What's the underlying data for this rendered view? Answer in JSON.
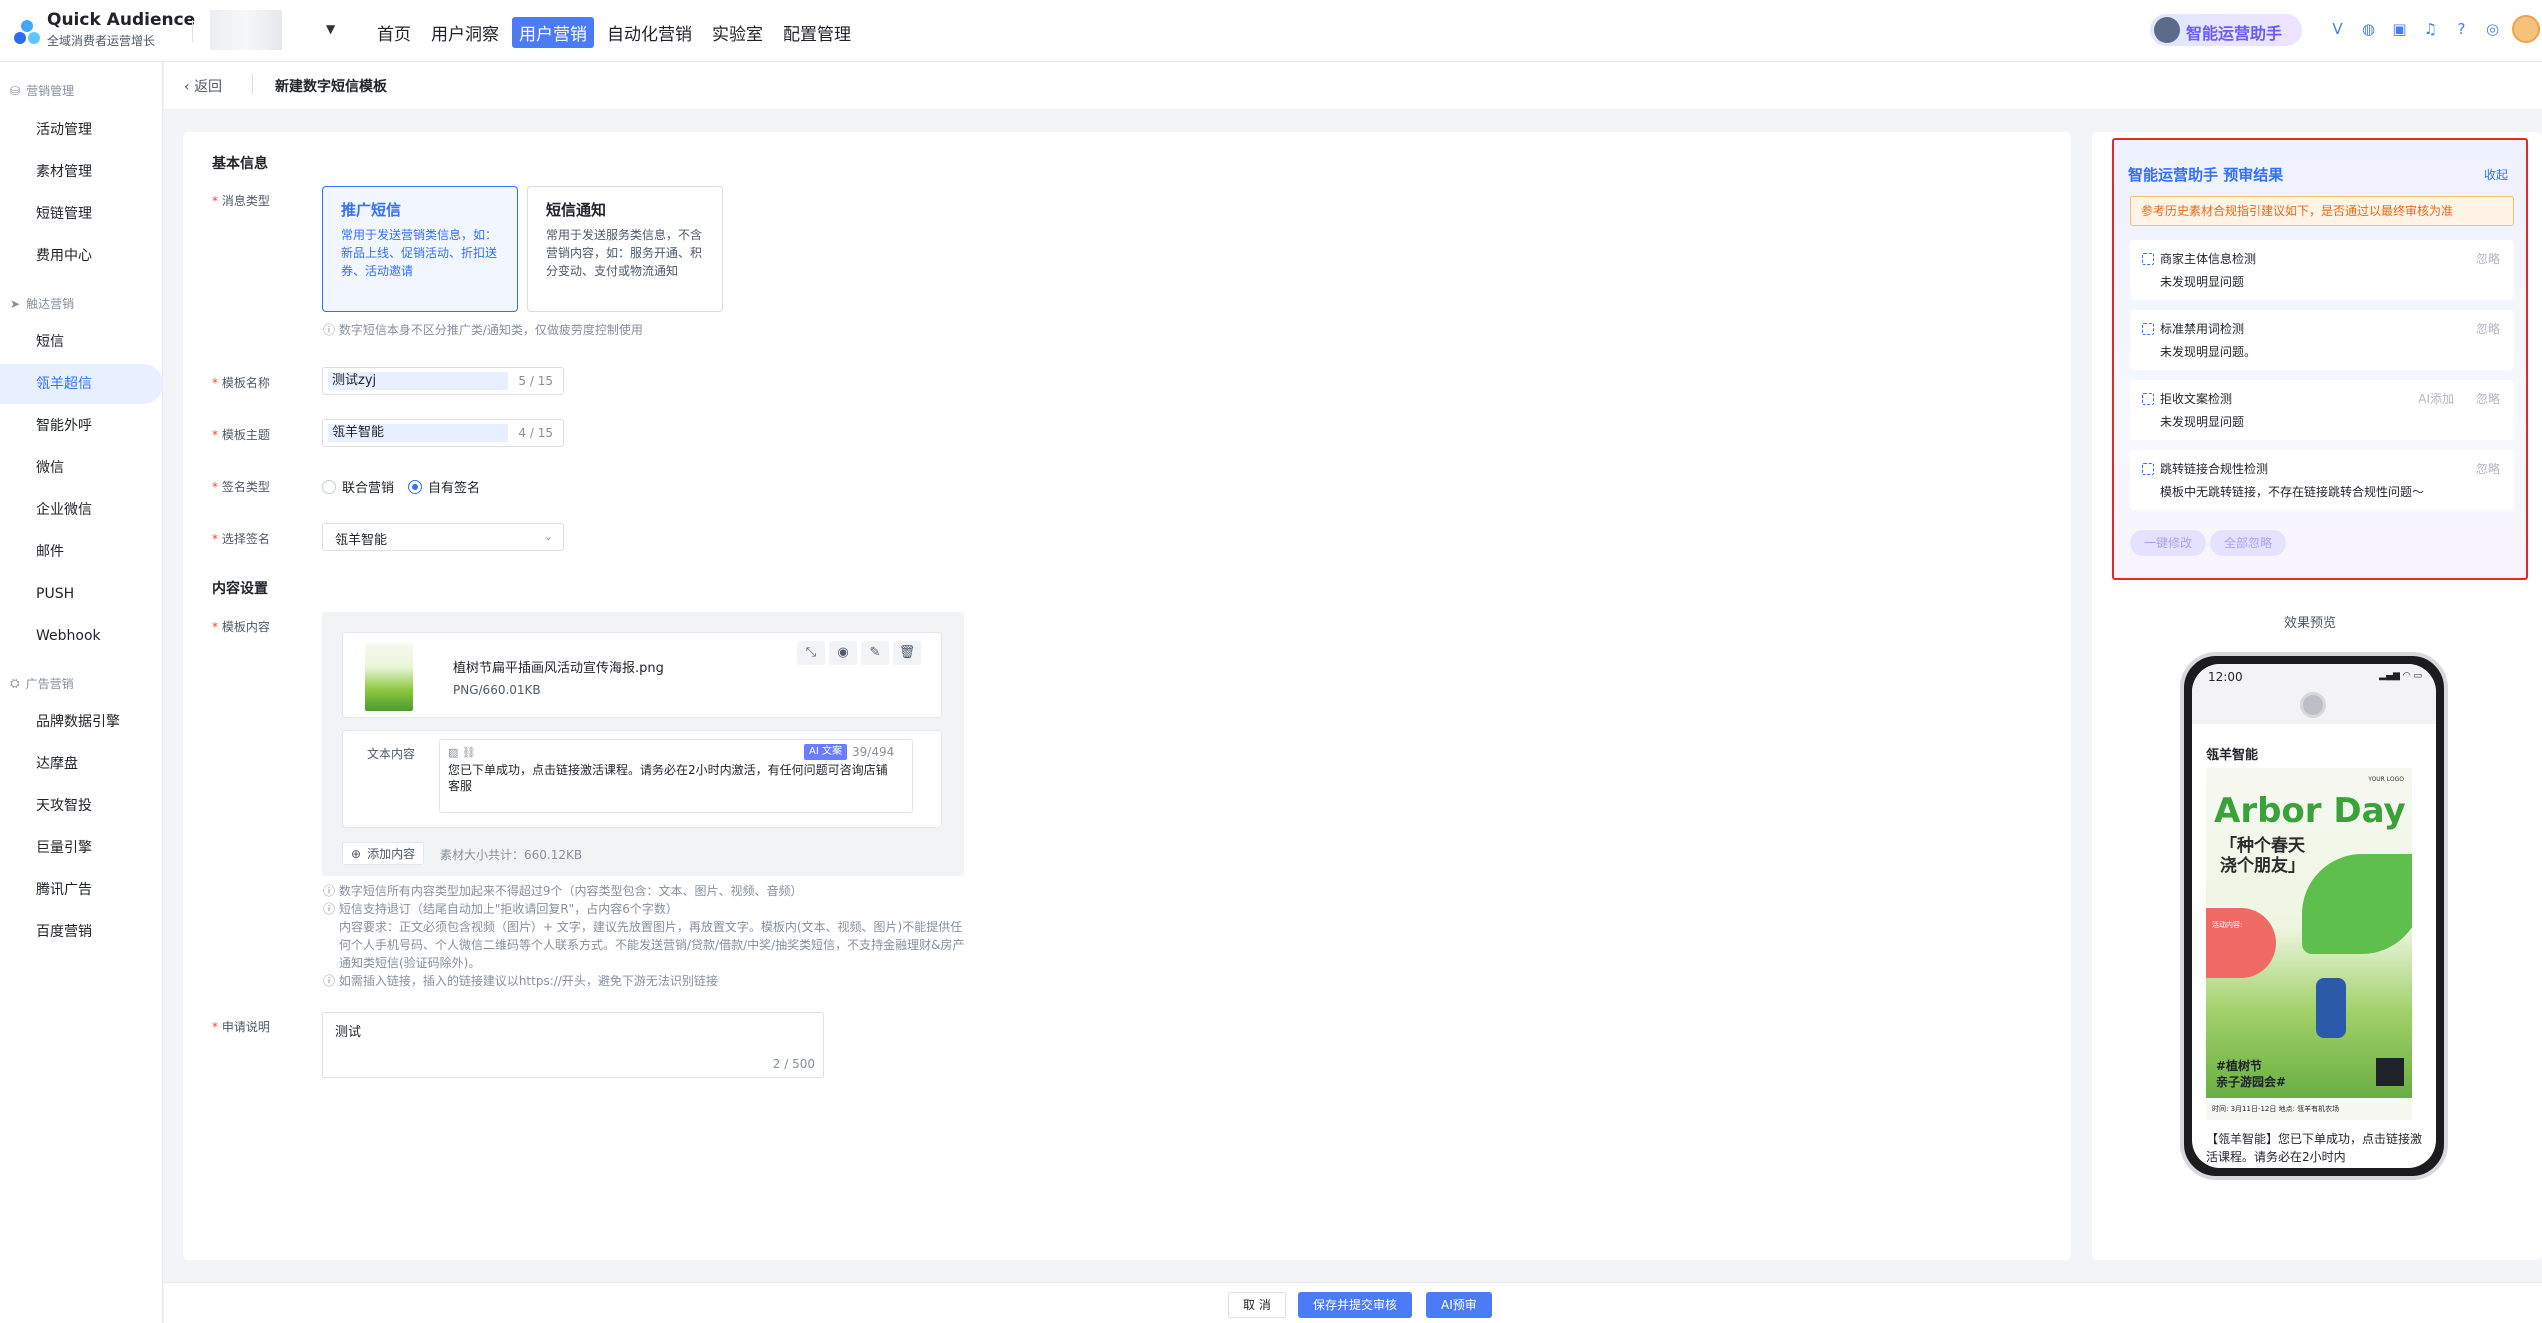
{
  "app": {
    "title": "Quick Audience",
    "subtitle": "全域消费者运营增长"
  },
  "nav": {
    "items": [
      "首页",
      "用户洞察",
      "用户营销",
      "自动化营销",
      "实验室",
      "配置管理"
    ],
    "active": "用户营销"
  },
  "assistant": {
    "label": "智能运营助手"
  },
  "top_icons": [
    "v-icon",
    "help-circle-icon",
    "briefcase-icon",
    "bell-icon",
    "question-icon",
    "globe-icon"
  ],
  "sidebar": {
    "groups": [
      {
        "title": "营销管理",
        "items": [
          "活动管理",
          "素材管理",
          "短链管理",
          "费用中心"
        ]
      },
      {
        "title": "触达营销",
        "items": [
          "短信",
          "瓴羊超信",
          "智能外呼",
          "微信",
          "企业微信",
          "邮件",
          "PUSH",
          "Webhook"
        ]
      },
      {
        "title": "广告营销",
        "items": [
          "品牌数据引擎",
          "达摩盘",
          "天攻智投",
          "巨量引擎",
          "腾讯广告",
          "百度营销"
        ]
      }
    ],
    "active": "瓴羊超信"
  },
  "breadcrumb": {
    "back": "返回",
    "title": "新建数字短信模板"
  },
  "form": {
    "basic_title": "基本信息",
    "msg_type_label": "消息类型",
    "type_promo": {
      "title": "推广短信",
      "desc": "常用于发送营销类信息，如：新品上线、促销活动、折扣送券、活动邀请"
    },
    "type_notice": {
      "title": "短信通知",
      "desc": "常用于发送服务类信息，不含营销内容，如：服务开通、积分变动、支付或物流通知"
    },
    "type_hint": "数字短信本身不区分推广类/通知类，仅做疲劳度控制使用",
    "name_label": "模板名称",
    "name_value": "测试zyj",
    "name_count": "5 / 15",
    "subject_label": "模板主题",
    "subject_value": "瓴羊智能",
    "subject_count": "4 / 15",
    "sign_type_label": "签名类型",
    "sign_options": [
      "联合营销",
      "自有签名"
    ],
    "sign_selected": "自有签名",
    "sign_select_label": "选择签名",
    "sign_select_value": "瓴羊智能",
    "content_title": "内容设置",
    "content_label": "模板内容",
    "file_name": "植树节扁平插画风活动宣传海报.png",
    "file_size": "PNG/660.01KB",
    "text_label": "文本内容",
    "ai_tag": "AI 文案",
    "text_count": "39/494",
    "text_value": "您已下单成功，点击链接激活课程。请务必在2小时内激活，有任何问题可咨询店铺客服",
    "add_content": "添加内容",
    "total_size": "素材大小共计：660.12KB",
    "notes": [
      "ⓘ 数字短信所有内容类型加起来不得超过9个（内容类型包含：文本、图片、视频、音频）",
      "ⓘ 短信支持退订（结尾自动加上\"拒收请回复R\"，占内容6个字数）",
      "内容要求：正文必须包含视频（图片）+ 文字，建议先放置图片，再放置文字。模板内(文本、视频、图片)不能提供任何个人手机号码、个人微信二维码等个人联系方式。不能发送营销/贷款/借款/中奖/抽奖类短信，不支持金融理财&房产通知类短信(验证码除外)。",
      "ⓘ 如需插入链接，插入的链接建议以https://开头，避免下游无法识别链接"
    ],
    "apply_label": "申请说明",
    "apply_value": "测试",
    "apply_count": "2 / 500"
  },
  "review": {
    "title": "智能运营助手 预审结果",
    "collapse": "收起",
    "warning": "参考历史素材合规指引建议如下，是否通过以最终审核为准",
    "checks": [
      {
        "name": "商家主体信息检测",
        "result": "未发现明显问题",
        "ignore": "忽略"
      },
      {
        "name": "标准禁用词检测",
        "result": "未发现明显问题。",
        "ignore": "忽略"
      },
      {
        "name": "拒收文案检测",
        "result": "未发现明显问题",
        "ignore": "忽略",
        "ai": "AI添加"
      },
      {
        "name": "跳转链接合规性检测",
        "result": "模板中无跳转链接，不存在链接跳转合规性问题～",
        "ignore": "忽略"
      }
    ],
    "btn_fix": "一键修改",
    "btn_ignore": "全部忽略"
  },
  "preview": {
    "title": "效果预览",
    "time": "12:00",
    "sender": "瓴羊智能",
    "poster_logo": "YOUR LOGO",
    "poster_title": "Arbor Day",
    "poster_sub1": "「种个春天",
    "poster_sub2": "浇个朋友」",
    "poster_red_title": "活动内容:",
    "poster_tag1": "#植树节",
    "poster_tag2": "亲子游园会#",
    "poster_bottom": "时间: 3月11日-12日   地点: 瓴羊有机农场",
    "message": "【瓴羊智能】您已下单成功，点击链接激活课程。请务必在2小时内"
  },
  "footer": {
    "cancel": "取 消",
    "submit": "保存并提交审核",
    "ai_review": "AI预审"
  }
}
